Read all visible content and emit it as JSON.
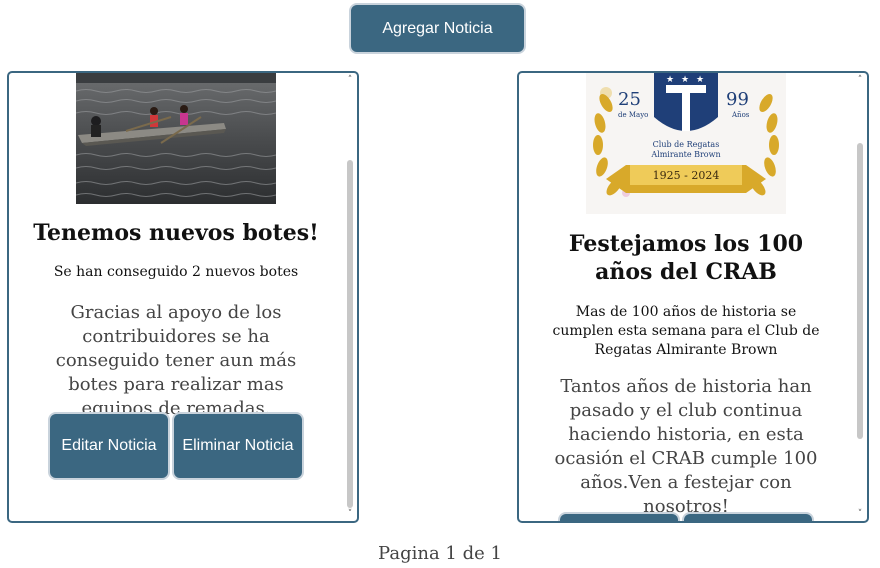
{
  "toolbar": {
    "add_news_label": "Agregar Noticia"
  },
  "news": [
    {
      "image_icon": "rowing-boat-photo",
      "title": "Tenemos nuevos botes!",
      "subtitle": "Se han conseguido 2 nuevos botes",
      "body": "Gracias al apoyo de los contribuidores se ha conseguido tener aun más botes para realizar mas equipos de remadas.",
      "edit_label": "Editar Noticia",
      "delete_label": "Eliminar Noticia"
    },
    {
      "image_icon": "club-anniversary-logo",
      "logo": {
        "left_number": "25",
        "left_text": "de Mayo",
        "right_number": "99",
        "right_text": "Años",
        "club_name_1": "Club de Regatas",
        "club_name_2": "Almirante Brown",
        "years": "1925 - 2024"
      },
      "title": "Festejamos los 100 años del CRAB",
      "subtitle": "Mas de 100 años de historia se cumplen esta semana para el Club de Regatas Almirante Brown",
      "body": "Tantos años de historia han pasado y el club continua haciendo historia, en esta ocasión el CRAB cumple 100 años.Ven a festejar con nosotros!"
    }
  ],
  "pagination": {
    "text": "Pagina 1 de 1"
  },
  "colors": {
    "button": "#3b6781",
    "card_border": "#3b6781"
  }
}
